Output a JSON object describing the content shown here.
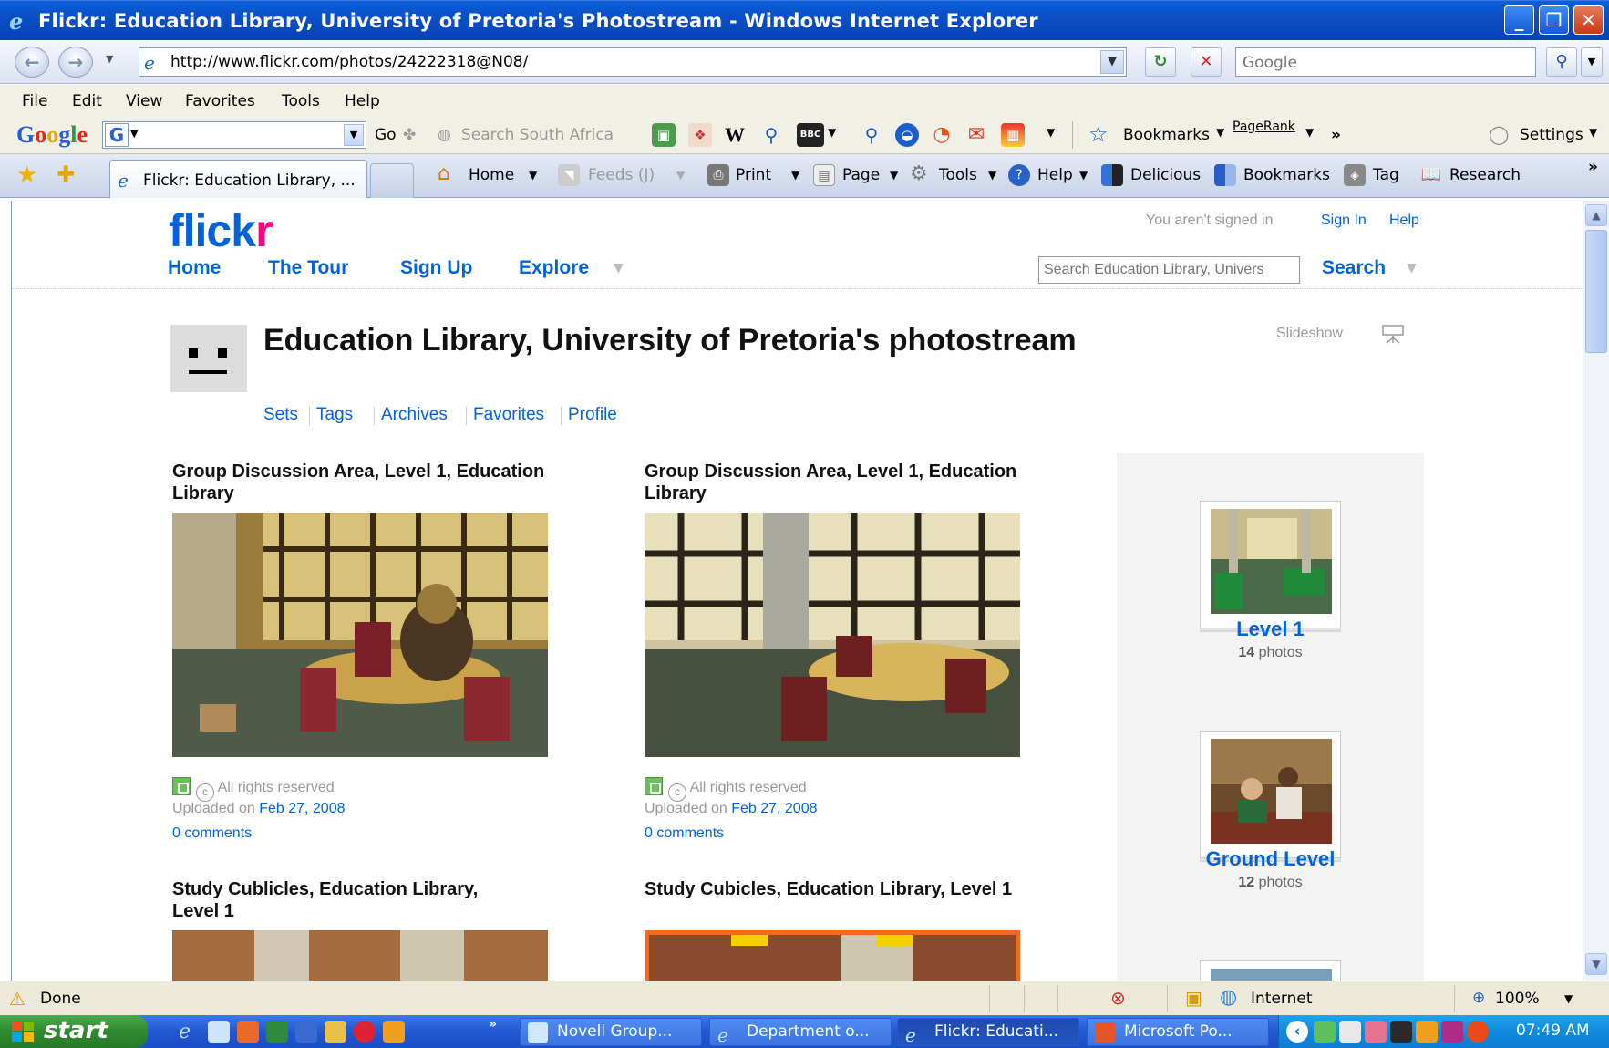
{
  "window": {
    "title": "Flickr: Education Library, University of Pretoria's Photostream - Windows Internet Explorer"
  },
  "address_bar": {
    "url": "http://www.flickr.com/photos/24222318@N08/",
    "search_placeholder": "Google"
  },
  "menu": {
    "items": [
      "File",
      "Edit",
      "View",
      "Favorites",
      "Tools",
      "Help"
    ]
  },
  "google_toolbar": {
    "logo": "Google",
    "go_label": "Go",
    "search_site": "Search South Africa",
    "bookmarks_label": "Bookmarks",
    "pagerank_label": "PageRank",
    "settings_label": "Settings"
  },
  "tabs": {
    "active_tab_label": "Flickr: Education Library, ...",
    "commands": {
      "home": "Home",
      "feeds": "Feeds (J)",
      "print": "Print",
      "page": "Page",
      "tools": "Tools",
      "help": "Help",
      "delicious": "Delicious",
      "bookmarks": "Bookmarks",
      "tag": "Tag",
      "research": "Research"
    }
  },
  "flickr": {
    "logo": {
      "part1": "flick",
      "part2": "r"
    },
    "nav": {
      "home": "Home",
      "tour": "The Tour",
      "signup": "Sign Up",
      "explore": "Explore"
    },
    "account": {
      "status": "You aren't signed in",
      "signin": "Sign In",
      "help": "Help"
    },
    "search": {
      "placeholder": "Search Education Library, Univers",
      "button": "Search"
    },
    "page_title": "Education Library, University of Pretoria's photostream",
    "subnav": [
      "Sets",
      "Tags",
      "Archives",
      "Favorites",
      "Profile"
    ],
    "slideshow": "Slideshow",
    "photos": [
      {
        "title": "Group Discussion Area, Level 1, Education Library",
        "rights": "All rights reserved",
        "uploaded_prefix": "Uploaded on",
        "uploaded_date": "Feb 27, 2008",
        "comments": "0 comments"
      },
      {
        "title": "Group Discussion Area, Level 1, Education Library",
        "rights": "All rights reserved",
        "uploaded_prefix": "Uploaded on",
        "uploaded_date": "Feb 27, 2008",
        "comments": "0 comments"
      },
      {
        "title": "Study Cublicles, Education Library, Level 1"
      },
      {
        "title": "Study Cubicles, Education Library, Level 1"
      }
    ],
    "sets": [
      {
        "title": "Level 1",
        "count": "14",
        "count_suffix": "photos"
      },
      {
        "title": "Ground Level",
        "count": "12",
        "count_suffix": "photos"
      }
    ]
  },
  "status_bar": {
    "status": "Done",
    "zone": "Internet",
    "zoom": "100%"
  },
  "taskbar": {
    "start": "start",
    "tasks": [
      "Novell Group...",
      "Department o...",
      "Flickr: Educati...",
      "Microsoft Po..."
    ],
    "clock": "07:49 AM"
  }
}
